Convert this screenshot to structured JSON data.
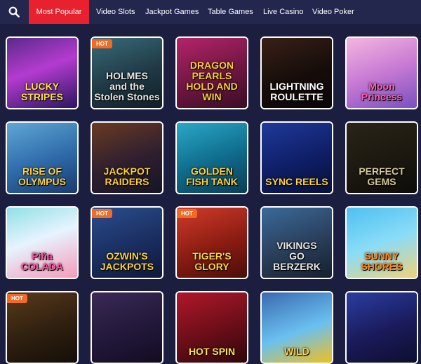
{
  "nav": {
    "tabs": [
      {
        "label": "Most Popular",
        "active": true
      },
      {
        "label": "Video Slots",
        "active": false
      },
      {
        "label": "Jackpot Games",
        "active": false
      },
      {
        "label": "Table Games",
        "active": false
      },
      {
        "label": "Live Casino",
        "active": false
      },
      {
        "label": "Video Poker",
        "active": false
      }
    ],
    "active_color": "#e8212e"
  },
  "hot_label": "HOT",
  "games": [
    {
      "title": "LUCKY\nSTRIPES",
      "hot": false
    },
    {
      "title": "HOLMES\nand the Stolen Stones",
      "hot": true
    },
    {
      "title": "DRAGON\nPEARLS\nHOLD AND WIN",
      "hot": false
    },
    {
      "title": "LIGHTNING\nROULETTE",
      "hot": false
    },
    {
      "title": "Moon\nPrincess",
      "hot": false
    },
    {
      "title": "RISE OF\nOLYMPUS",
      "hot": false
    },
    {
      "title": "JACKPOT\nRAIDERS",
      "hot": false
    },
    {
      "title": "GOLDEN\nFISH TANK",
      "hot": false
    },
    {
      "title": "SYNC REELS",
      "hot": false
    },
    {
      "title": "PERFECT\nGEMS",
      "hot": false
    },
    {
      "title": "Piña\nCOLADA",
      "hot": false
    },
    {
      "title": "OZWIN'S\nJACKPOTS",
      "hot": true
    },
    {
      "title": "TIGER'S\nGLORY",
      "hot": true
    },
    {
      "title": "VIKINGS\nGO\nBERZERK",
      "hot": false
    },
    {
      "title": "SUNNY\nSHORES",
      "hot": false
    },
    {
      "title": "",
      "hot": true
    },
    {
      "title": "",
      "hot": false
    },
    {
      "title": "HOT SPIN",
      "hot": false
    },
    {
      "title": "WILD",
      "hot": false
    },
    {
      "title": "",
      "hot": false
    }
  ]
}
